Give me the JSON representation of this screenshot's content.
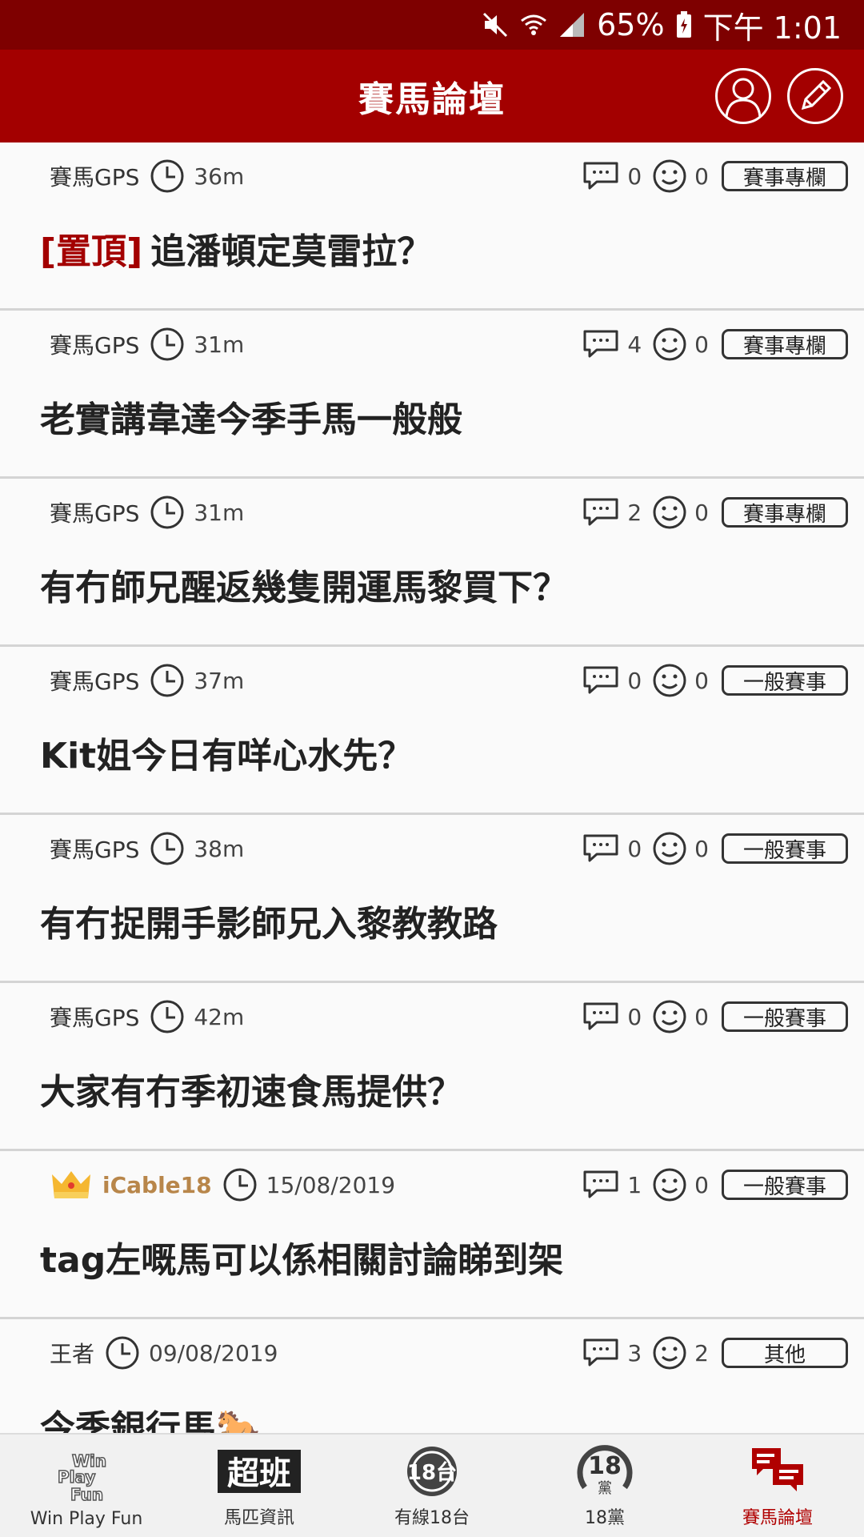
{
  "status_bar": {
    "battery": "65%",
    "time": "下午 1:01"
  },
  "header": {
    "title": "賽馬論壇"
  },
  "posts": [
    {
      "author": "賽馬GPS",
      "time": "36m",
      "comments": "0",
      "likes": "0",
      "tag": "賽事專欄",
      "pinned_label": "[置頂]",
      "title": "追潘頓定莫雷拉？"
    },
    {
      "author": "賽馬GPS",
      "time": "31m",
      "comments": "4",
      "likes": "0",
      "tag": "賽事專欄",
      "title": "老實講韋達今季手馬一般般"
    },
    {
      "author": "賽馬GPS",
      "time": "31m",
      "comments": "2",
      "likes": "0",
      "tag": "賽事專欄",
      "title": "有冇師兄醒返幾隻開運馬黎買下？"
    },
    {
      "author": "賽馬GPS",
      "time": "37m",
      "comments": "0",
      "likes": "0",
      "tag": "一般賽事",
      "title": "Kit姐今日有咩心水先？"
    },
    {
      "author": "賽馬GPS",
      "time": "38m",
      "comments": "0",
      "likes": "0",
      "tag": "一般賽事",
      "title": "有冇捉開手影師兄入黎教教路"
    },
    {
      "author": "賽馬GPS",
      "time": "42m",
      "comments": "0",
      "likes": "0",
      "tag": "一般賽事",
      "title": "大家有冇季初速食馬提供？"
    },
    {
      "author": "iCable18",
      "time": "15/08/2019",
      "comments": "1",
      "likes": "0",
      "tag": "一般賽事",
      "title": "tag左嘅馬可以係相關討論睇到架"
    },
    {
      "author": "王者",
      "time": "09/08/2019",
      "comments": "3",
      "likes": "2",
      "tag": "其他",
      "title": "今季銀行馬🐎"
    }
  ],
  "bottom_nav": [
    {
      "label": "Win Play Fun"
    },
    {
      "label": "馬匹資訊",
      "icon_text": "超班"
    },
    {
      "label": "有線18台",
      "icon_text": "18台"
    },
    {
      "label": "18黨",
      "icon_text": "18",
      "icon_sub": "黨"
    },
    {
      "label": "賽馬論壇"
    }
  ],
  "colors": {
    "header": "#a30000",
    "status_bar": "#7e0000",
    "accent": "#b00000",
    "vip": "#b8864a"
  }
}
